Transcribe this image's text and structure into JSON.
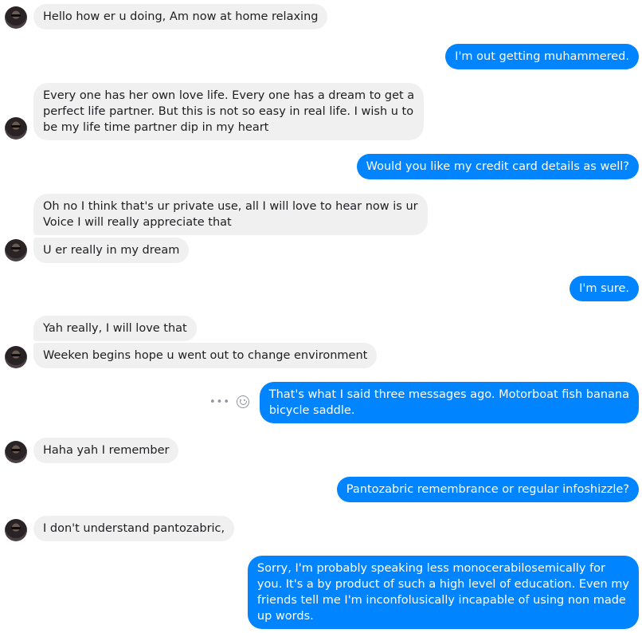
{
  "messages": {
    "m1": "Hello how er u doing,  Am now at home relaxing",
    "m2": "I'm out getting muhammered.",
    "m3": [
      "Every one has her own love life. Every one has a dream to get a",
      "perfect life partner. But this is not so easy in real life. I wish u to",
      "be my life time partner dip in my heart"
    ],
    "m4": "Would you like my credit card details as well?",
    "m5": [
      "Oh no I think that's ur private use, all I will love to hear now is ur",
      "Voice I will really appreciate that"
    ],
    "m6": "U er really in my dream",
    "m7": "I'm sure.",
    "m8": "Yah really,  I will love that",
    "m9": "Weeken begins hope u went out to change environment",
    "m10": [
      "That's what I said three messages ago. Motorboat fish banana",
      "bicycle saddle."
    ],
    "m11": "Haha yah I remember",
    "m12": "Pantozabric remembrance or regular infoshizzle?",
    "m13": "I don't understand pantozabric,",
    "m14": [
      "Sorry,  I'm probably speaking less monocerabilosemically for",
      "you. It's a by product of such a high level of education. Even my",
      "friends tell me I'm inconfolusically incapable of using non made",
      "up words."
    ]
  },
  "icons": {
    "avatar": "contact-avatar",
    "more": "more-options-icon",
    "react": "emoji-reaction-icon"
  },
  "colors": {
    "incoming_bubble": "#f1f0f0",
    "outgoing_bubble": "#0084ff",
    "outgoing_text": "#ffffff",
    "incoming_text": "#1c1e21"
  }
}
